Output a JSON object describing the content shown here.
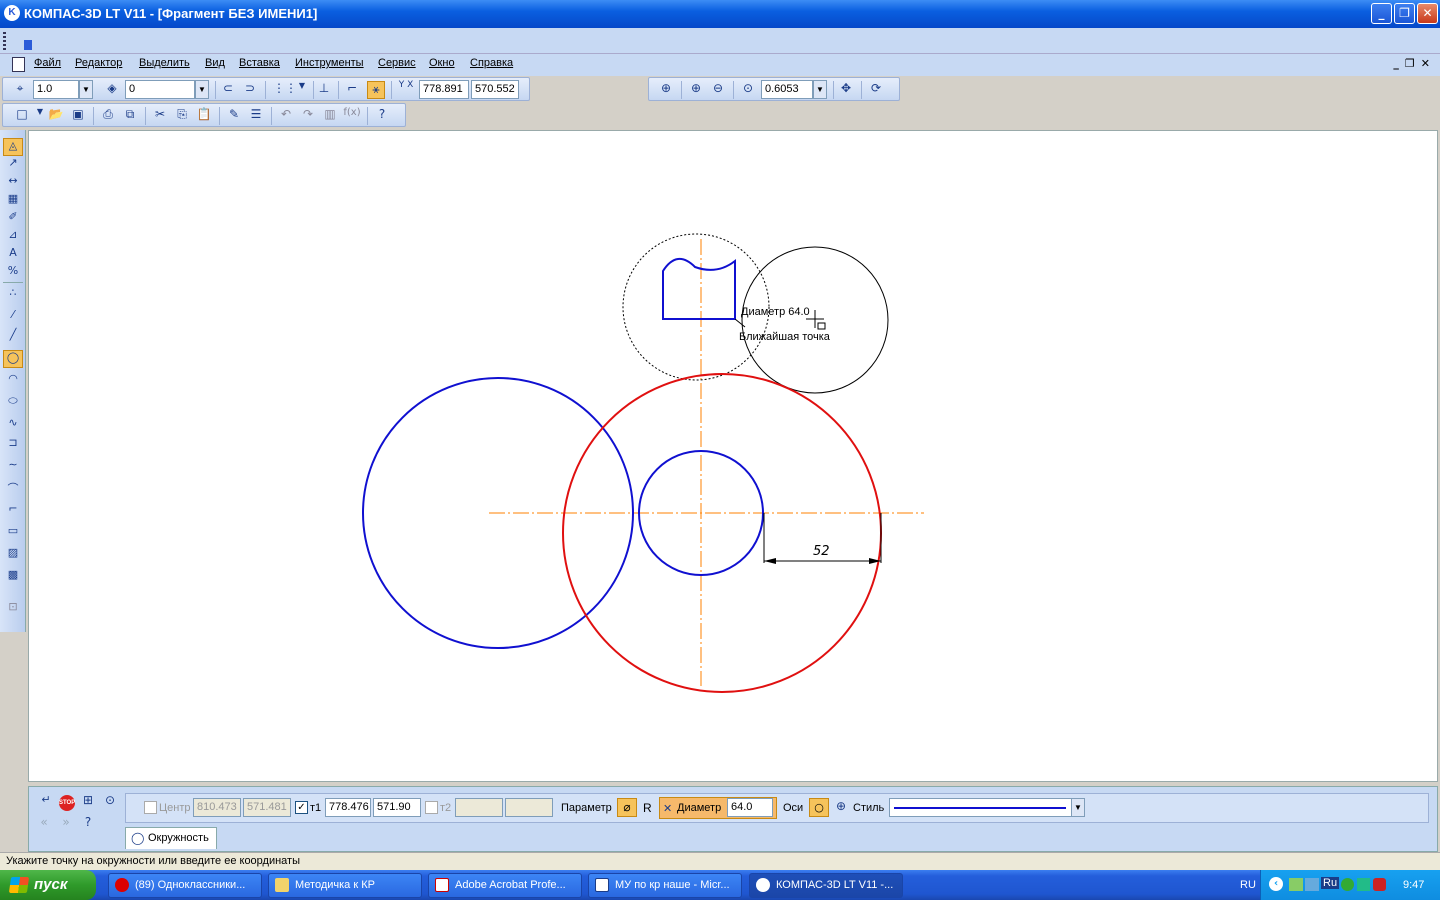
{
  "window": {
    "title": "КОМПАС-3D LT V11 - [Фрагмент БЕЗ ИМЕНИ1]",
    "app_icon_text": "K"
  },
  "menu": [
    "Файл",
    "Редактор",
    "Выделить",
    "Вид",
    "Вставка",
    "Инструменты",
    "Сервис",
    "Окно",
    "Справка"
  ],
  "toolbar_current": {
    "step": "1.0",
    "layer": "0",
    "cursor_x": "778.891",
    "cursor_y": "570.552",
    "coord_label": "Y X"
  },
  "toolbar_view": {
    "zoom": "0.6053"
  },
  "drawing": {
    "hint_diameter": "Диаметр 64.0",
    "hint_snap": "Ближайшая точка",
    "dimension_text": "52",
    "colors": {
      "blue": "#1010d0",
      "red": "#e01010",
      "axis": "#ff8000",
      "black": "#000000"
    }
  },
  "property_panel": {
    "center_label": "Центр",
    "center_x": "810.473",
    "center_y": "571.481",
    "t1_label": "т1",
    "t1_x": "778.476",
    "t1_y": "571.90",
    "t2_label": "т2",
    "param_label": "Параметр",
    "r_label": "R",
    "diameter_label": "Диаметр",
    "diameter_value": "64.0",
    "axes_label": "Оси",
    "style_label": "Стиль",
    "tab_label": "Окружность",
    "stop_text": "STOP"
  },
  "status": "Укажите точку на окружности или введите ее координаты",
  "taskbar": {
    "start": "пуск",
    "items": [
      "(89) Одноклассники...",
      "Методичка к КР",
      "Adobe Acrobat Profe...",
      "МУ по кр наше - Micr...",
      "КОМПАС-3D LT V11 -..."
    ],
    "lang": "RU",
    "tray_ru": "Ru",
    "time": "9:47"
  }
}
